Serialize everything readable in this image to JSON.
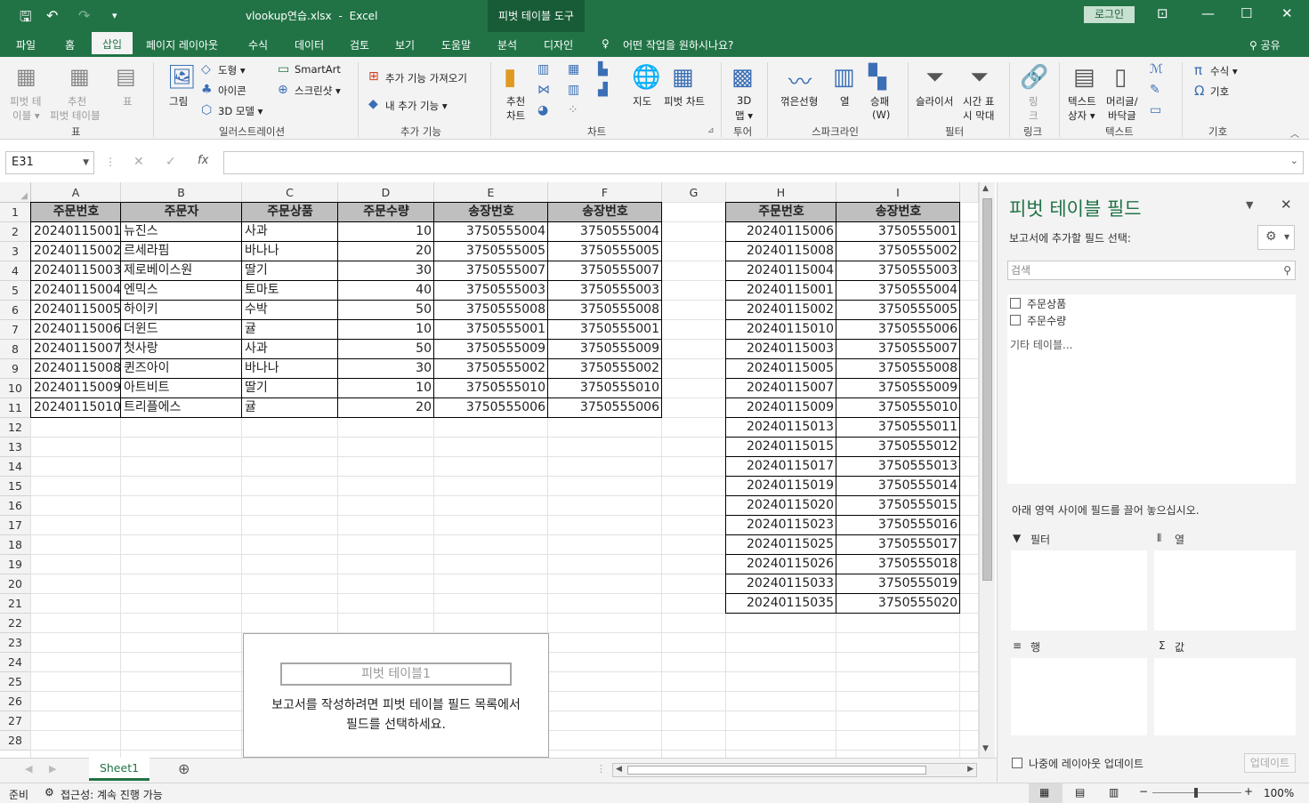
{
  "titlebar": {
    "filename": "vlookup연습.xlsx",
    "sep": "-",
    "app": "Excel",
    "context_tab": "피벗 테이블 도구",
    "login": "로그인"
  },
  "tabs": [
    "파일",
    "홈",
    "삽입",
    "페이지 레이아웃",
    "수식",
    "데이터",
    "검토",
    "보기",
    "도움말",
    "분석",
    "디자인"
  ],
  "active_tab": "삽입",
  "tellme": "어떤 작업을 원하시나요?",
  "share": "공유",
  "ribbon": {
    "tables": {
      "pivot": "피벗 테",
      "pivot2": "이블 ▾",
      "rec1": "추천",
      "rec2": "피벗 테이블",
      "table": "표",
      "group": "표"
    },
    "illus": {
      "picture": "그림",
      "shapes": "도형 ▾",
      "icons": "아이콘",
      "model3d": "3D 모델 ▾",
      "smartart": "SmartArt",
      "screenshot": "스크린샷 ▾",
      "group": "일러스트레이션"
    },
    "addins": {
      "get": "추가 기능 가져오기",
      "my": "내 추가 기능 ▾",
      "group": "추가 기능"
    },
    "charts": {
      "rec1": "추천",
      "rec2": "차트",
      "map": "지도",
      "pivotchart": "피벗 차트",
      "group": "차트"
    },
    "tours": {
      "map3d1": "3D",
      "map3d2": "맵 ▾",
      "group": "투어"
    },
    "spark": {
      "line": "꺾은선형",
      "col": "열",
      "wl1": "승패",
      "wl2": "(W)",
      "group": "스파크라인"
    },
    "filters": {
      "slicer": "슬라이서",
      "tl1": "시간 표",
      "tl2": "시 막대",
      "group": "필터"
    },
    "links": {
      "link1": "링",
      "link2": "크",
      "group": "링크"
    },
    "text": {
      "tb1": "텍스트",
      "tb2": "상자 ▾",
      "hf1": "머리글/",
      "hf2": "바닥글",
      "group": "텍스트"
    },
    "symbols": {
      "eq": "수식 ▾",
      "sym": "기호",
      "group": "기호"
    }
  },
  "namebox": "E31",
  "fx_label": "fx",
  "columns": [
    "A",
    "B",
    "C",
    "D",
    "E",
    "F",
    "G",
    "H",
    "I"
  ],
  "rows": [
    "1",
    "2",
    "3",
    "4",
    "5",
    "6",
    "7",
    "8",
    "9",
    "10",
    "11",
    "12",
    "13",
    "14",
    "15",
    "16",
    "17",
    "18",
    "19",
    "20",
    "21",
    "22",
    "23",
    "24",
    "25",
    "26",
    "27",
    "28"
  ],
  "table1": {
    "headers": [
      "주문번호",
      "주문자",
      "주문상품",
      "주문수량",
      "송장번호",
      "송장번호"
    ],
    "rows": [
      [
        "20240115001",
        "뉴진스",
        "사과",
        "10",
        "3750555004",
        "3750555004"
      ],
      [
        "20240115002",
        "르세라핌",
        "바나나",
        "20",
        "3750555005",
        "3750555005"
      ],
      [
        "20240115003",
        "제로베이스원",
        "딸기",
        "30",
        "3750555007",
        "3750555007"
      ],
      [
        "20240115004",
        "엔믹스",
        "토마토",
        "40",
        "3750555003",
        "3750555003"
      ],
      [
        "20240115005",
        "하이키",
        "수박",
        "50",
        "3750555008",
        "3750555008"
      ],
      [
        "20240115006",
        "더윈드",
        "귤",
        "10",
        "3750555001",
        "3750555001"
      ],
      [
        "20240115007",
        "첫사랑",
        "사과",
        "50",
        "3750555009",
        "3750555009"
      ],
      [
        "20240115008",
        "퀸즈아이",
        "바나나",
        "30",
        "3750555002",
        "3750555002"
      ],
      [
        "20240115009",
        "아트비트",
        "딸기",
        "10",
        "3750555010",
        "3750555010"
      ],
      [
        "20240115010",
        "트리플에스",
        "귤",
        "20",
        "3750555006",
        "3750555006"
      ]
    ]
  },
  "table2": {
    "headers": [
      "주문번호",
      "송장번호"
    ],
    "rows": [
      [
        "20240115006",
        "3750555001"
      ],
      [
        "20240115008",
        "3750555002"
      ],
      [
        "20240115004",
        "3750555003"
      ],
      [
        "20240115001",
        "3750555004"
      ],
      [
        "20240115002",
        "3750555005"
      ],
      [
        "20240115010",
        "3750555006"
      ],
      [
        "20240115003",
        "3750555007"
      ],
      [
        "20240115005",
        "3750555008"
      ],
      [
        "20240115007",
        "3750555009"
      ],
      [
        "20240115009",
        "3750555010"
      ],
      [
        "20240115013",
        "3750555011"
      ],
      [
        "20240115015",
        "3750555012"
      ],
      [
        "20240115017",
        "3750555013"
      ],
      [
        "20240115019",
        "3750555014"
      ],
      [
        "20240115020",
        "3750555015"
      ],
      [
        "20240115023",
        "3750555016"
      ],
      [
        "20240115025",
        "3750555017"
      ],
      [
        "20240115026",
        "3750555018"
      ],
      [
        "20240115033",
        "3750555019"
      ],
      [
        "20240115035",
        "3750555020"
      ]
    ]
  },
  "pivot_placeholder": {
    "name": "피벗 테이블1",
    "message1": "보고서를 작성하려면 피벗 테이블 필드 목록에서",
    "message2": "필드를 선택하세요."
  },
  "sheet_tab": "Sheet1",
  "status": {
    "ready": "준비",
    "accessibility": "접근성: 계속 진행 가능",
    "zoom": "100%"
  },
  "panel": {
    "title": "피벗 테이블 필드",
    "subtitle": "보고서에 추가할 필드 선택:",
    "search_placeholder": "검색",
    "fields": [
      "주문상품",
      "주문수량"
    ],
    "more": "기타 테이블...",
    "drag_hint": "아래 영역 사이에 필드를 끌어 놓으십시오.",
    "area_filter": "필터",
    "area_cols": "열",
    "area_rows": "행",
    "area_values": "값",
    "defer": "나중에 레이아웃 업데이트",
    "update": "업데이트"
  },
  "colors": {
    "excel_green": "#217346",
    "header_fill": "#bfbfbf"
  }
}
